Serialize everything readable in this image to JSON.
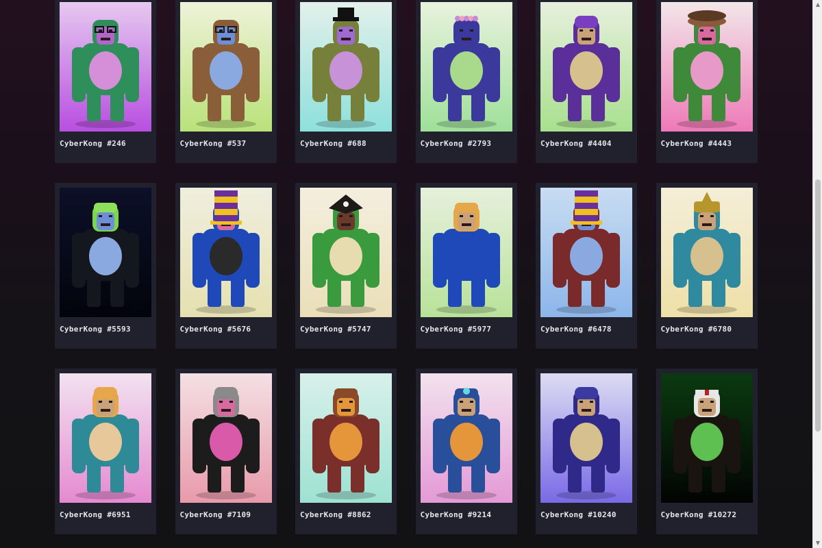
{
  "gallery": {
    "items": [
      {
        "label": "CyberKong #246",
        "bg_top": "#e6c8f0",
        "bg_bottom": "#b84fe0",
        "body": "#2f8f5a",
        "belly": "#d58fd8",
        "face": "#b366c9",
        "head": "#2f8f5a",
        "hat": "glasses",
        "hat_color": "#111111"
      },
      {
        "label": "CyberKong #537",
        "bg_top": "#eef2d8",
        "bg_bottom": "#b9e27a",
        "body": "#8b5e3a",
        "belly": "#8aa9e0",
        "face": "#6e8fd6",
        "head": "#8b5e3a",
        "hat": "glasses",
        "hat_color": "#1a1a1a"
      },
      {
        "label": "CyberKong #688",
        "bg_top": "#e3f0ea",
        "bg_bottom": "#8ee0dc",
        "body": "#77803a",
        "belly": "#c892d8",
        "face": "#a06bd0",
        "head": "#77803a",
        "hat": "tophat",
        "hat_color": "#111111"
      },
      {
        "label": "CyberKong #2793",
        "bg_top": "#e8f2dc",
        "bg_bottom": "#9fe09a",
        "body": "#3b3a9c",
        "belly": "#a9d98a",
        "face": "#3b3a9c",
        "head": "#3b3a9c",
        "hat": "flowers",
        "hat_color": "#c58ad6"
      },
      {
        "label": "CyberKong #4404",
        "bg_top": "#e6f0dc",
        "bg_bottom": "#a8e08e",
        "body": "#5a2f9a",
        "belly": "#d6c08e",
        "face": "#c9a27a",
        "head": "#5a2f9a",
        "hat": "beanie",
        "hat_color": "#7a3fc0"
      },
      {
        "label": "CyberKong #4443",
        "bg_top": "#f2e6e8",
        "bg_bottom": "#ee7ab8",
        "body": "#3f8a3a",
        "belly": "#e79ac8",
        "face": "#d86aa0",
        "head": "#3f8a3a",
        "hat": "drum",
        "hat_color": "#8a5a3a"
      },
      {
        "label": "CyberKong #5593",
        "bg_top": "#0c1028",
        "bg_bottom": "#02040c",
        "body": "#14181e",
        "belly": "#8aa9e0",
        "face": "#6e8fd6",
        "head": "#7ad64a",
        "hat": "cap",
        "hat_color": "#8ee05a"
      },
      {
        "label": "CyberKong #5676",
        "bg_top": "#efeede",
        "bg_bottom": "#e6e0b0",
        "body": "#1f48b8",
        "belly": "#2a2a2a",
        "face": "#d86aa0",
        "head": "#1f48b8",
        "hat": "striped",
        "hat_color": "#6a2f9a"
      },
      {
        "label": "CyberKong #5747",
        "bg_top": "#f4eede",
        "bg_bottom": "#eadfb8",
        "body": "#3a9a3e",
        "belly": "#e6dcb0",
        "face": "#6b3a2a",
        "head": "#3a9a3e",
        "hat": "pirate",
        "hat_color": "#1e1a18"
      },
      {
        "label": "CyberKong #5977",
        "bg_top": "#e6f0dc",
        "bg_bottom": "#b8e29a",
        "body": "#1f48b8",
        "belly": "#1f48b8",
        "face": "#c9a27a",
        "head": "#e6a74a",
        "hat": "cap",
        "hat_color": "#e6a74a"
      },
      {
        "label": "CyberKong #6478",
        "bg_top": "#c8dcf2",
        "bg_bottom": "#8cb6ea",
        "body": "#7a2a2a",
        "belly": "#8aa9e0",
        "face": "#6e8fd6",
        "head": "#7a2a2a",
        "hat": "striped",
        "hat_color": "#6a2f9a"
      },
      {
        "label": "CyberKong #6780",
        "bg_top": "#f4eed8",
        "bg_bottom": "#eee0a8",
        "body": "#2f8aa0",
        "belly": "#d6c08e",
        "face": "#c9a27a",
        "head": "#2f8aa0",
        "hat": "samurai",
        "hat_color": "#b8962e"
      },
      {
        "label": "CyberKong #6951",
        "bg_top": "#f2e2f0",
        "bg_bottom": "#e58ad0",
        "body": "#2e8a96",
        "belly": "#e6c89a",
        "face": "#c9a27a",
        "head": "#e6a74a",
        "hat": "beanie",
        "hat_color": "#e6a74a"
      },
      {
        "label": "CyberKong #7109",
        "bg_top": "#f4e0e4",
        "bg_bottom": "#e89aaa",
        "body": "#1c1c1c",
        "belly": "#d85aa8",
        "face": "#d86aa0",
        "head": "#8a8a8a",
        "hat": "beanie",
        "hat_color": "#8a8a8a"
      },
      {
        "label": "CyberKong #8862",
        "bg_top": "#d8f0ea",
        "bg_bottom": "#9ee2d2",
        "body": "#7a2f2a",
        "belly": "#e6963a",
        "face": "#e6963a",
        "head": "#8a4a2a",
        "hat": "cap",
        "hat_color": "#8a4a2a"
      },
      {
        "label": "CyberKong #9214",
        "bg_top": "#f2e2ee",
        "bg_bottom": "#e49ad6",
        "body": "#2a4f9a",
        "belly": "#e6963a",
        "face": "#c9a27a",
        "head": "#2a4f9a",
        "hat": "doctor",
        "hat_color": "#6ad6e0"
      },
      {
        "label": "CyberKong #10240",
        "bg_top": "#dcdcf2",
        "bg_bottom": "#7a6ae6",
        "body": "#2f2a8a",
        "belly": "#d6c08e",
        "face": "#c9a27a",
        "head": "#2f2a8a",
        "hat": "beanie",
        "hat_color": "#3a3aa0"
      },
      {
        "label": "CyberKong #10272",
        "bg_top": "#0a3a10",
        "bg_bottom": "#020402",
        "body": "#1a1410",
        "belly": "#5ec050",
        "face": "#c9a27a",
        "head": "#e6e6e6",
        "hat": "headband",
        "hat_color": "#e6e6e6"
      }
    ]
  }
}
